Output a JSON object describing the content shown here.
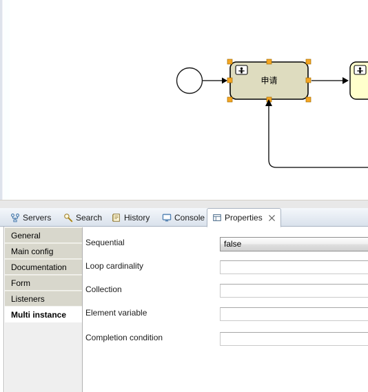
{
  "diagram": {
    "start_event": {
      "name": "start-event",
      "shape": "circle"
    },
    "tasks": [
      {
        "id": "task-申请",
        "label": "申请",
        "type": "user-task",
        "selected": true,
        "fill": "#dedcbf",
        "stroke": "#000000",
        "handle_color": "#f5a623"
      },
      {
        "id": "task-partial-right",
        "label": "",
        "type": "user-task",
        "selected": false,
        "fill": "#ffffcc",
        "stroke": "#000000"
      }
    ],
    "connections": [
      {
        "name": "start-to-task",
        "type": "sequence-flow"
      },
      {
        "name": "task-to-next",
        "type": "sequence-flow"
      },
      {
        "name": "loopback-flow",
        "type": "sequence-flow"
      }
    ]
  },
  "tabbar": {
    "tabs": [
      {
        "label": "Servers",
        "icon": "servers-icon",
        "active": false,
        "closeable": false
      },
      {
        "label": "Search",
        "icon": "search-icon",
        "active": false,
        "closeable": false
      },
      {
        "label": "History",
        "icon": "history-icon",
        "active": false,
        "closeable": false
      },
      {
        "label": "Console",
        "icon": "console-icon",
        "active": false,
        "closeable": false
      },
      {
        "label": "Properties",
        "icon": "properties-icon",
        "active": true,
        "closeable": true
      }
    ]
  },
  "properties": {
    "tabs": [
      {
        "label": "General",
        "selected": false
      },
      {
        "label": "Main config",
        "selected": false
      },
      {
        "label": "Documentation",
        "selected": false
      },
      {
        "label": "Form",
        "selected": false
      },
      {
        "label": "Listeners",
        "selected": false
      },
      {
        "label": "Multi instance",
        "selected": true
      }
    ],
    "fields": [
      {
        "label": "Sequential",
        "control": "combo",
        "value": "false",
        "placeholder": ""
      },
      {
        "label": "Loop cardinality",
        "control": "text",
        "value": "",
        "placeholder": ""
      },
      {
        "label": "Collection",
        "control": "text",
        "value": "",
        "placeholder": ""
      },
      {
        "label": "Element variable",
        "control": "text",
        "value": "",
        "placeholder": ""
      },
      {
        "label": "Completion condition",
        "control": "text",
        "value": "",
        "placeholder": ""
      }
    ]
  },
  "colors": {
    "selected_task_fill": "#dedcbf",
    "task_fill": "#ffffcc",
    "selection_handle": "#f5a623",
    "tab_active_bg": "#ffffff",
    "tabbar_bg": "#dae2ec",
    "prop_tab_bg": "#d8d7cc"
  }
}
